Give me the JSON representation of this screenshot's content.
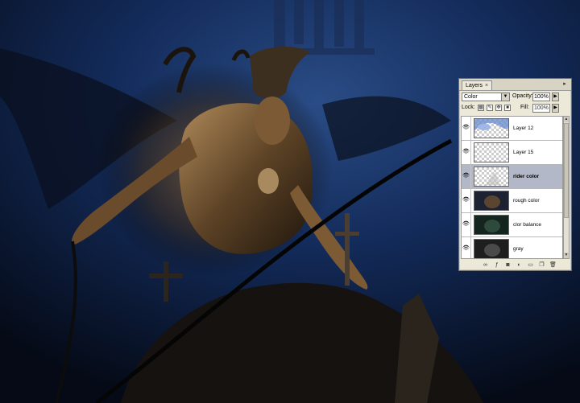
{
  "panel": {
    "tab_label": "Layers",
    "tab_close": "×",
    "menu_icon": "▸",
    "blend_mode": "Color",
    "opacity_label": "Opacity:",
    "opacity_value": "100%",
    "lock_label": "Lock:",
    "fill_label": "Fill:",
    "fill_value": "100%",
    "layers": [
      {
        "name": "Layer 12",
        "visible": true,
        "selected": false
      },
      {
        "name": "Layer 15",
        "visible": true,
        "selected": false
      },
      {
        "name": "rider color",
        "visible": true,
        "selected": true
      },
      {
        "name": "rough color",
        "visible": true,
        "selected": false
      },
      {
        "name": "clor balance",
        "visible": true,
        "selected": false
      },
      {
        "name": "gray",
        "visible": true,
        "selected": false
      }
    ],
    "bottom_icons": [
      "link-icon",
      "fx-icon",
      "mask-icon",
      "adjustment-icon",
      "group-icon",
      "new-layer-icon",
      "trash-icon"
    ]
  },
  "colors": {
    "canvas_bg": "#0d1a36",
    "panel_bg": "#ece9d8",
    "selected_row": "#b3b8c8"
  }
}
